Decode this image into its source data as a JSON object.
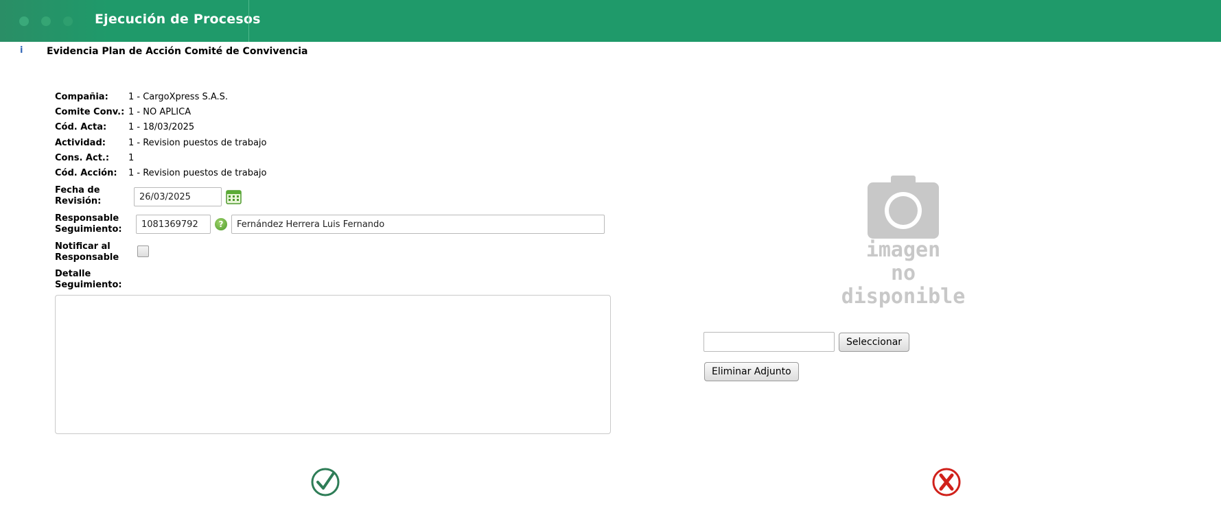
{
  "header": {
    "title": "Ejecución de Procesos"
  },
  "section": {
    "title": "Evidencia Plan de Acción Comité de Convivencia",
    "icon": "info-icon"
  },
  "info": [
    {
      "label": "Compañia:",
      "value": "1 - CargoXpress S.A.S."
    },
    {
      "label": "Comite Conv.:",
      "value": "1 - NO APLICA"
    },
    {
      "label": "Cód. Acta:",
      "value": "1 - 18/03/2025"
    },
    {
      "label": "Actividad:",
      "value": "1 - Revision puestos de trabajo"
    },
    {
      "label": "Cons. Act.:",
      "value": "1"
    },
    {
      "label": "Cód. Acción:",
      "value": "1 - Revision puestos de trabajo"
    }
  ],
  "form": {
    "fecha_label": "Fecha de Revisión:",
    "fecha_value": "26/03/2025",
    "responsable_label": "Responsable Seguimiento:",
    "responsable_id": "1081369792",
    "responsable_name": "Fernández Herrera Luis Fernando",
    "notificar_label": "Notificar al Responsable",
    "notificar_checked": false,
    "detalle_label": "Detalle Seguimiento:",
    "detalle_value": ""
  },
  "image_placeholder": {
    "line1": "imagen",
    "line2": "no disponible",
    "icon": "camera-icon"
  },
  "upload": {
    "file_value": "",
    "select_label": "Seleccionar",
    "delete_label": "Eliminar Adjunto"
  },
  "actions": {
    "ok_icon": "check-circle-icon",
    "cancel_icon": "x-circle-icon"
  },
  "colors": {
    "header": "#1f9a6a",
    "ok": "#2e7d57",
    "cancel": "#d0211b"
  }
}
